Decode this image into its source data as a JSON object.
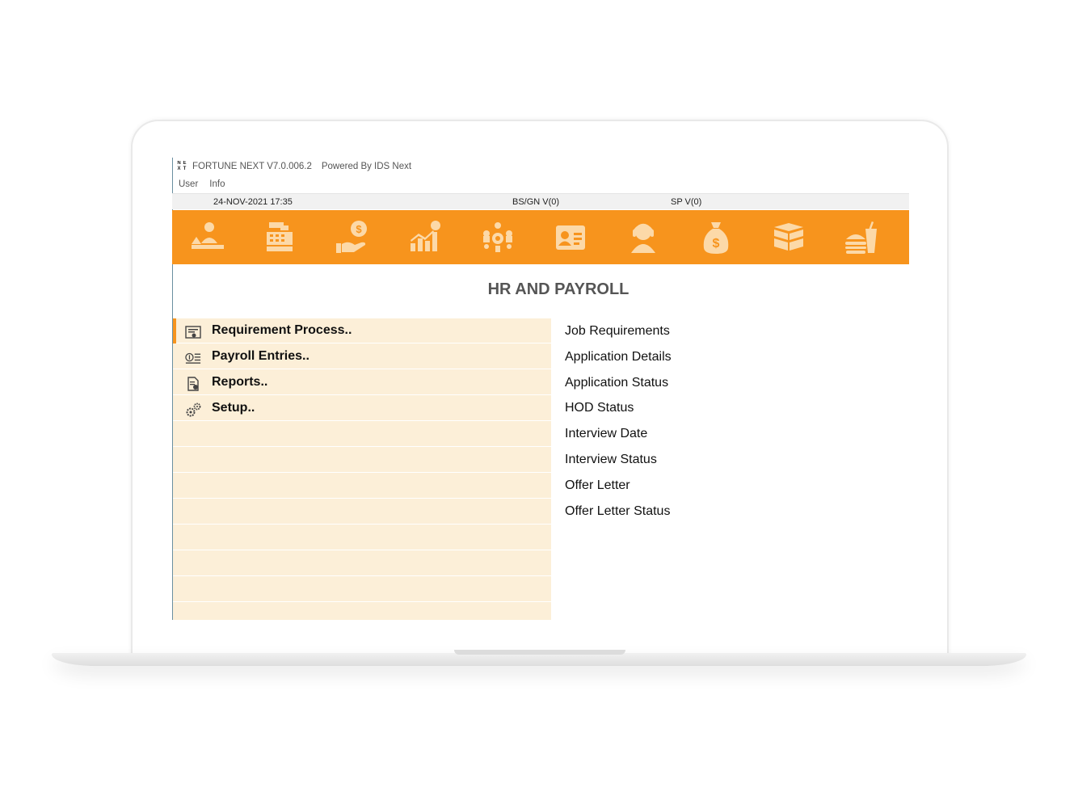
{
  "window": {
    "title": "FORTUNE NEXT  V7.0.006.2",
    "powered_by": "Powered By IDS Next",
    "logo_letters": [
      "N",
      "E",
      "X",
      "T"
    ]
  },
  "menubar": {
    "items": [
      "User",
      "Info"
    ]
  },
  "statusbar": {
    "datetime": "24-NOV-2021 17:35",
    "bs_gn": "BS/GN V(0)",
    "sp": "SP V(0)"
  },
  "toolbar": {
    "color": "#f7941d",
    "icons": [
      "front-office-icon",
      "cash-register-icon",
      "hand-money-icon",
      "growth-chart-icon",
      "network-hub-icon",
      "id-card-icon",
      "support-agent-icon",
      "money-bag-icon",
      "boxes-icon",
      "food-drink-icon"
    ]
  },
  "page": {
    "title": "HR AND PAYROLL"
  },
  "menu": {
    "items": [
      {
        "label": "Requirement Process..",
        "icon": "certificate-icon"
      },
      {
        "label": "Payroll Entries..",
        "icon": "payroll-list-icon"
      },
      {
        "label": "Reports..",
        "icon": "report-icon"
      },
      {
        "label": "Setup..",
        "icon": "gears-icon"
      }
    ]
  },
  "submenu": {
    "items": [
      "Job Requirements",
      "Application Details",
      "Application Status",
      "HOD Status",
      "Interview Date",
      "Interview Status",
      "Offer Letter",
      "Offer Letter Status"
    ]
  }
}
